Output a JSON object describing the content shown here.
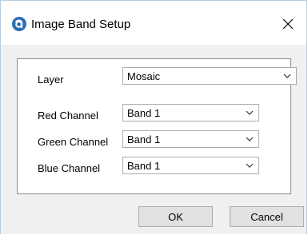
{
  "dialog": {
    "title": "Image Band Setup",
    "close_glyph": "×"
  },
  "form": {
    "layer_label": "Layer",
    "layer_value": "Mosaic",
    "red_label": "Red Channel",
    "red_value": "Band 1",
    "green_label": "Green Channel",
    "green_value": "Band 1",
    "blue_label": "Blue Channel",
    "blue_value": "Band 1"
  },
  "buttons": {
    "ok_label": "OK",
    "cancel_label": "Cancel"
  },
  "icons": {
    "app": "app-logo-icon",
    "close": "close-icon",
    "dropdown": "chevron-down-icon"
  },
  "colors": {
    "app_icon": "#2e6db4",
    "window_border": "#b8cde0",
    "button_face": "#e1e1e1"
  }
}
